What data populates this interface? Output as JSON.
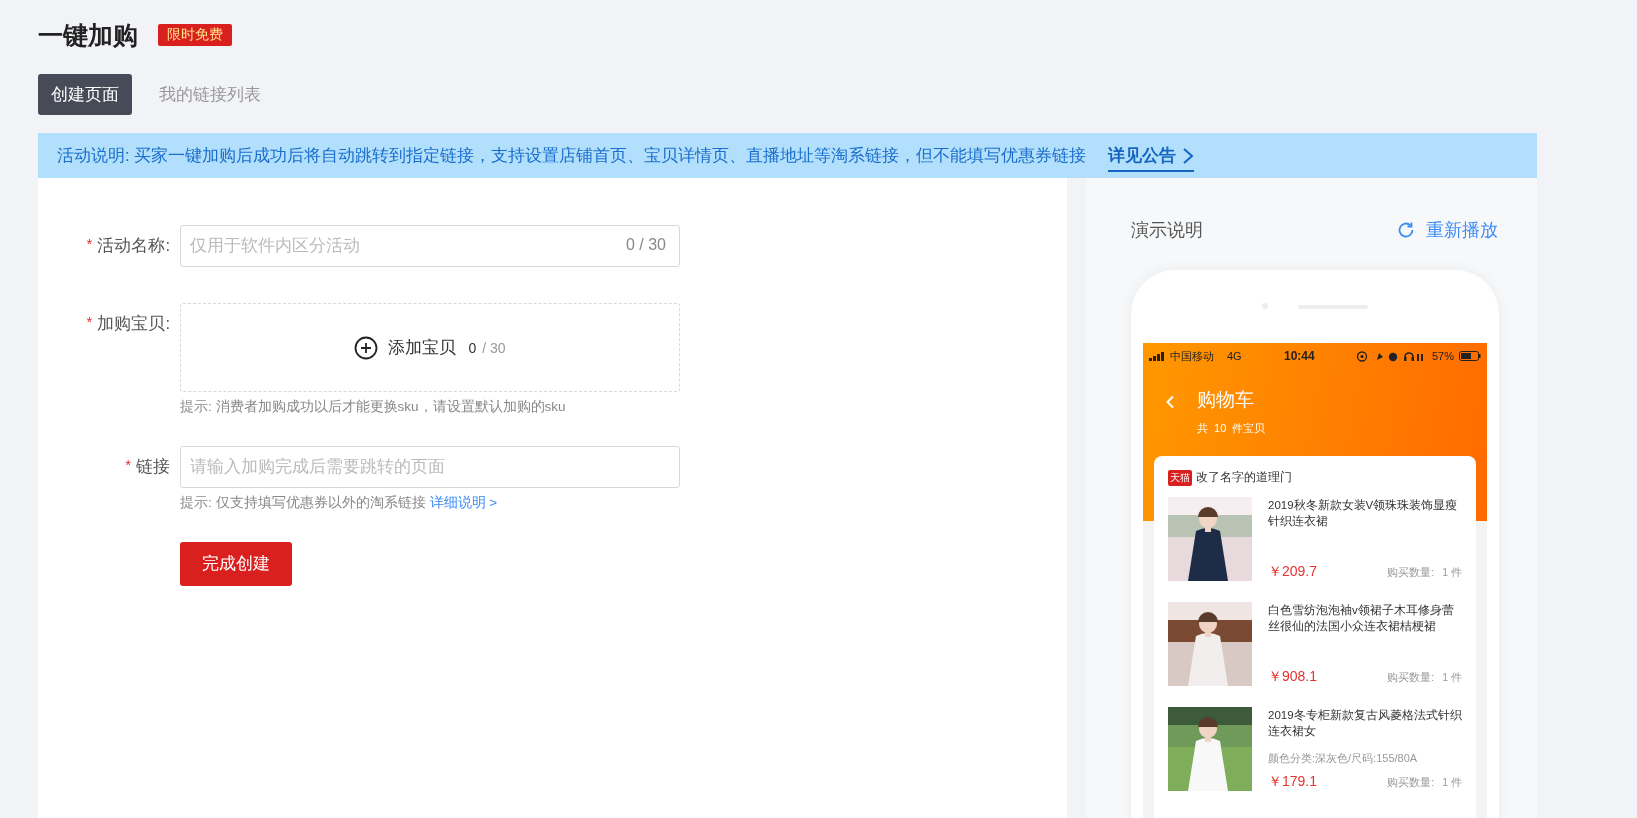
{
  "header": {
    "title": "一键加购",
    "badge": "限时免费"
  },
  "tabs": [
    {
      "label": "创建页面",
      "selected": true
    },
    {
      "label": "我的链接列表",
      "selected": false
    }
  ],
  "notice": {
    "text": "活动说明: 买家一键加购后成功后将自动跳转到指定链接，支持设置店铺首页、宝贝详情页、直播地址等淘系链接，但不能填写优惠券链接",
    "link": "详见公告"
  },
  "form": {
    "fields": [
      {
        "kind": "text",
        "required_mark": "*",
        "label": "活动名称:",
        "placeholder": "仅用于软件内区分活动",
        "counter": "0 / 30"
      },
      {
        "kind": "picker",
        "required_mark": "*",
        "label": "加购宝贝:",
        "action": "添加宝贝",
        "count": "0",
        "max": "/ 30",
        "hint": "提示: 消费者加购成功以后才能更换sku，请设置默认加购的sku"
      },
      {
        "kind": "text",
        "required_mark": "*",
        "label": "链接",
        "placeholder": "请输入加购完成后需要跳转的页面",
        "hint": "提示: 仅支持填写优惠券以外的淘系链接",
        "hint_link": "详细说明 >"
      }
    ],
    "submit": "完成创建"
  },
  "demo": {
    "title": "演示说明",
    "replay": "重新播放",
    "phone": {
      "status": {
        "carrier": "中国移动",
        "network": "4G",
        "time": "10:44",
        "battery": "57%"
      },
      "title": "购物车",
      "subtitle": "共  10  件宝贝",
      "shop": {
        "badge": "天猫",
        "name": "改了名字的道理门"
      },
      "items": [
        {
          "title": "2019秋冬新款女装V领珠珠装饰显瘦针织连衣裙",
          "price": "￥209.7",
          "qty_label": "购买数量:",
          "qty": "1 件"
        },
        {
          "title": "白色雪纺泡泡袖v领裙子木耳修身蕾丝很仙的法国小众连衣裙桔梗裙",
          "price": "￥908.1",
          "qty_label": "购买数量:",
          "qty": "1 件"
        },
        {
          "title": "2019冬专柜新款复古风菱格法式针织连衣裙女",
          "spec": "颜色分类:深灰色/尺码:155/80A",
          "price": "￥179.1",
          "qty_label": "购买数量:",
          "qty": "1 件"
        }
      ]
    }
  }
}
